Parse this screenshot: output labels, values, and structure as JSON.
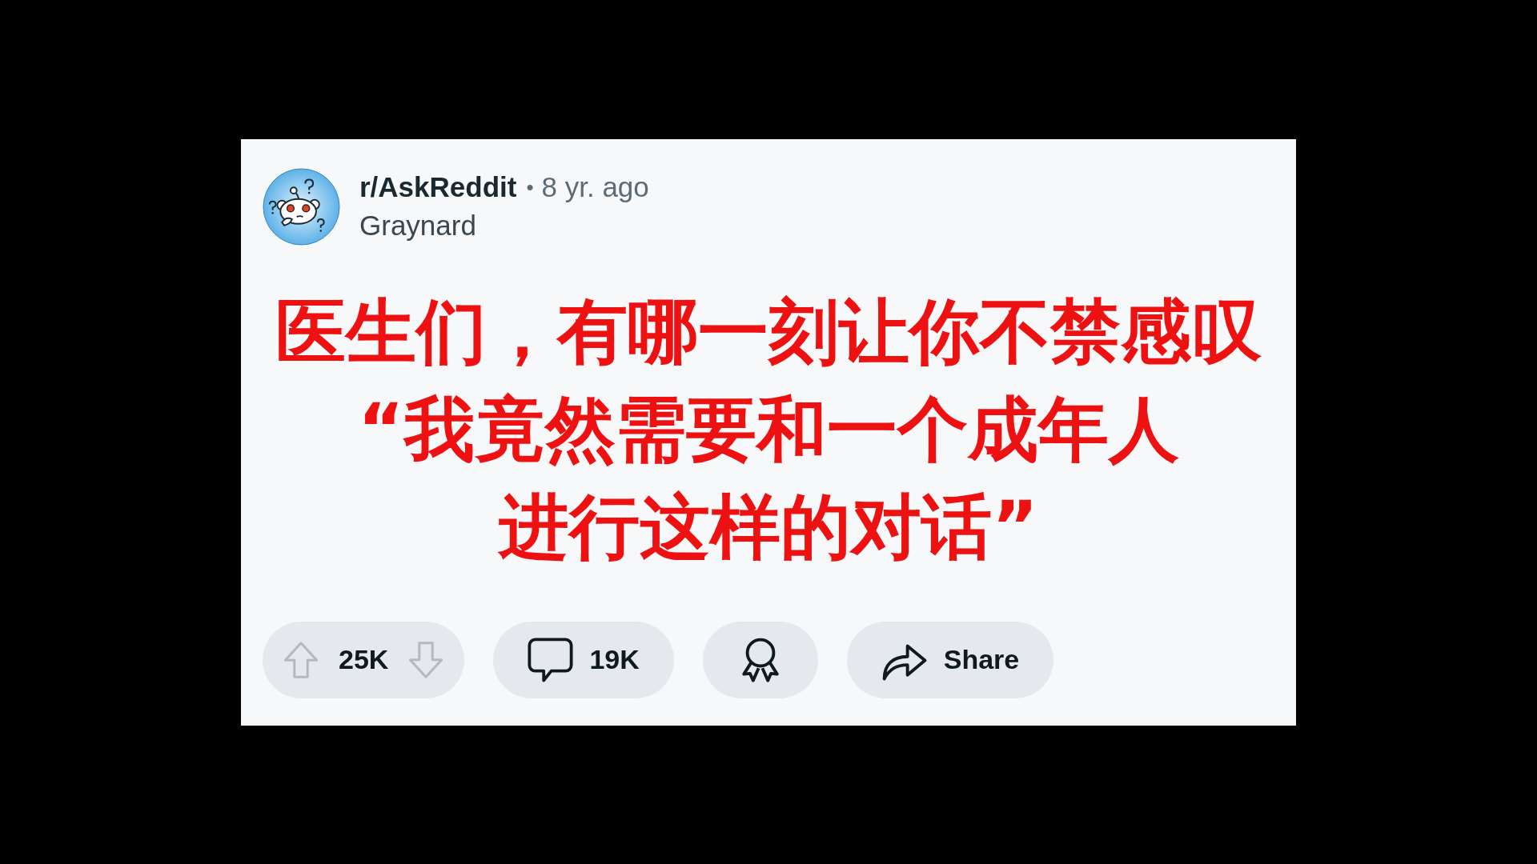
{
  "post": {
    "community": "r/AskReddit",
    "separator": "•",
    "age": "8 yr. ago",
    "author": "Graynard",
    "title_lines": [
      "医生们，有哪一刻让你不禁感叹",
      "“我竟然需要和一个成年人",
      "进行这样的对话”"
    ]
  },
  "actions": [
    {
      "kind": "vote",
      "count": "25K"
    },
    {
      "kind": "comments",
      "count": "19K"
    },
    {
      "kind": "award"
    },
    {
      "kind": "share",
      "label": "Share"
    }
  ]
}
